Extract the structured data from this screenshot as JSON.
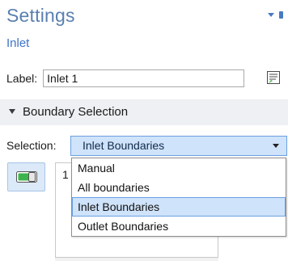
{
  "header": {
    "title": "Settings",
    "subtitle": "Inlet"
  },
  "label_field": {
    "label": "Label:",
    "value": "Inlet 1"
  },
  "section": {
    "title": "Boundary Selection"
  },
  "selection": {
    "label": "Selection:",
    "value": "Inlet Boundaries",
    "options": [
      "Manual",
      "All boundaries",
      "Inlet Boundaries",
      "Outlet Boundaries"
    ],
    "selected_index": 2
  },
  "list": {
    "entries": [
      "1"
    ]
  },
  "colors": {
    "title": "#5a7fb0",
    "subtitle": "#3f74c8",
    "accent_blue": "#4a79c2",
    "selection_fill": "#cfe3fa",
    "selection_border": "#6aa0e0",
    "section_bar": "#eef0f3",
    "toggle_green": "#3cb44b"
  },
  "icons": {
    "header_collapse": "triangle-down-icon",
    "header_pin": "pin-icon",
    "label_button": "text-label-icon",
    "section_toggle": "section-collapse-icon",
    "combo_arrow": "chevron-down-icon",
    "active_toggle": "toggle-switch-icon"
  }
}
